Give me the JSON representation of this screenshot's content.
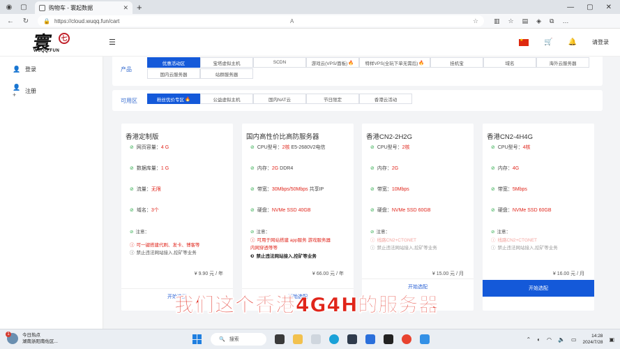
{
  "browser": {
    "tab_title": "购物车 - 寰起数据",
    "url": "https://cloud.wuqq.fun/cart"
  },
  "logo": {
    "calligraphy": "寰",
    "seal": "七",
    "brand": "WUQQ.FUN"
  },
  "header": {
    "login": "请登录"
  },
  "sidebar": {
    "items": [
      {
        "label": "登录"
      },
      {
        "label": "注册"
      }
    ]
  },
  "product_filter": {
    "label": "产品",
    "rows": [
      [
        "优惠活动区",
        "宝塔虚拟主机",
        "SCDN",
        "游戏云(VPS/面板)",
        "特样VPS(全玩下单无需后)",
        "挂机宝",
        "域名",
        "海外云服务器"
      ],
      [
        "国内云服务器",
        "站群服务器"
      ]
    ]
  },
  "zone_filter": {
    "label": "可用区",
    "chips": [
      "粉丝优价专区",
      "公益虚拟主机",
      "国内NAT云",
      "节日限定",
      "香港云活动"
    ]
  },
  "cards": [
    {
      "name": "香港定制版",
      "features": [
        {
          "label": "网页容量：",
          "value": "4 G"
        },
        {
          "label": "数据库量：",
          "value": "1 G"
        },
        {
          "label": "流量：",
          "value": "无限"
        },
        {
          "label": "域名：",
          "value": "3个"
        }
      ],
      "notes": [
        "注意：",
        "可一键搭建代刷、发卡、博客等",
        "禁止违法网站接入,挖矿等业务"
      ],
      "price": "¥ 9.90 元 / 年",
      "button": "开始选配"
    },
    {
      "name": "国内高性价比高防服务器",
      "features": [
        {
          "label": "CPU型号：",
          "value": "2核",
          "extra": " E5-2680V2电信"
        },
        {
          "label": "内存：",
          "value": "2G",
          "extra": " DDR4"
        },
        {
          "label": "带宽：",
          "value": "30Mbps/50Mbps",
          "extra": " 共享IP"
        },
        {
          "label": "硬盘：",
          "value": "NVMe SSD 40GB"
        }
      ],
      "notes": [
        "注意：",
        "可用于网站搭建 app服务 游戏服务器",
        "内网穿透等等",
        "禁止违法网站接入,挖矿等业务"
      ],
      "price": "¥ 66.00 元 / 年",
      "button": "开始选配"
    },
    {
      "name": "香港CN2-2H2G",
      "features": [
        {
          "label": "CPU型号：",
          "value": "2核"
        },
        {
          "label": "内存：",
          "value": "2G"
        },
        {
          "label": "带宽：",
          "value": "10Mbps"
        },
        {
          "label": "硬盘：",
          "value": "NVMe SSD 60GB"
        }
      ],
      "notes": [
        "注意：",
        "线路CN2+CTGNET",
        "禁止违法网站接入,挖矿等业务"
      ],
      "price": "¥ 15.00 元 / 月",
      "button": "开始选配"
    },
    {
      "name": "香港CN2-4H4G",
      "features": [
        {
          "label": "CPU型号：",
          "value": "4核"
        },
        {
          "label": "内存：",
          "value": "4G"
        },
        {
          "label": "带宽：",
          "value": "5Mbps"
        },
        {
          "label": "硬盘：",
          "value": "NVMe SSD 60GB"
        }
      ],
      "notes": [
        "注意：",
        "线路CN2+CTGNET",
        "禁止违法网站接入,挖矿等业务"
      ],
      "price": "¥ 16.00 元 / 月",
      "button": "开始选配"
    }
  ],
  "subtitle": "我们这个香港4G4H的服务器",
  "taskbar": {
    "weather_title": "今日热点",
    "weather_sub": "湖南浙阳南佐区...",
    "badge": "1",
    "search": "搜索",
    "time": "14:28",
    "date": "2024/7/28"
  },
  "colors": {
    "accent": "#1459d9",
    "highlight": "#e0261c",
    "check": "#2eaa4b"
  }
}
